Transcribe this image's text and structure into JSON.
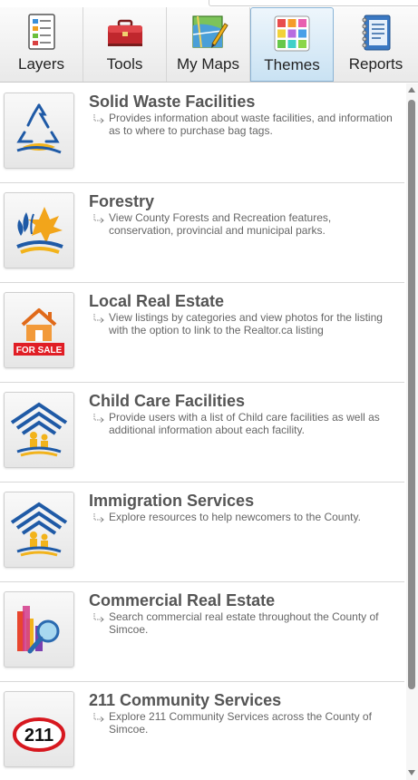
{
  "tabs": [
    {
      "label": "Layers",
      "icon": "layers-icon",
      "active": false
    },
    {
      "label": "Tools",
      "icon": "toolbox-icon",
      "active": false
    },
    {
      "label": "My Maps",
      "icon": "map-pencil-icon",
      "active": false
    },
    {
      "label": "Themes",
      "icon": "color-grid-icon",
      "active": true
    },
    {
      "label": "Reports",
      "icon": "notebook-icon",
      "active": false
    }
  ],
  "items": [
    {
      "title": "Solid Waste Facilities",
      "description": "Provides information about waste facilities, and information as to where to purchase bag tags.",
      "icon": "recycle-icon"
    },
    {
      "title": "Forestry",
      "description": "View County Forests and Recreation features, conservation, provincial and municipal parks.",
      "icon": "leaves-icon"
    },
    {
      "title": "Local Real Estate",
      "description": "View listings by categories and view photos for the listing with the option to link to the Realtor.ca listing",
      "icon": "house-for-sale-icon",
      "badge": "FOR SALE"
    },
    {
      "title": "Child Care Facilities",
      "description": "Provide users with a list of Child care facilities as well as additional information about each facility.",
      "icon": "child-care-icon"
    },
    {
      "title": "Immigration Services",
      "description": "Explore resources to help newcomers to the County.",
      "icon": "immigration-icon"
    },
    {
      "title": "Commercial Real Estate",
      "description": "Search commercial real estate throughout the County of Simcoe.",
      "icon": "bar-chart-magnifier-icon"
    },
    {
      "title": "211 Community Services",
      "description": "Explore 211 Community Services across the County of Simcoe.",
      "icon": "oval-211-icon",
      "badge": "211"
    }
  ],
  "colors": {
    "active_tab_bg": "#c9e2f3",
    "title_text": "#555555",
    "description_text": "#666666",
    "brand_blue": "#1f5aa6",
    "brand_yellow": "#f2b31b"
  }
}
